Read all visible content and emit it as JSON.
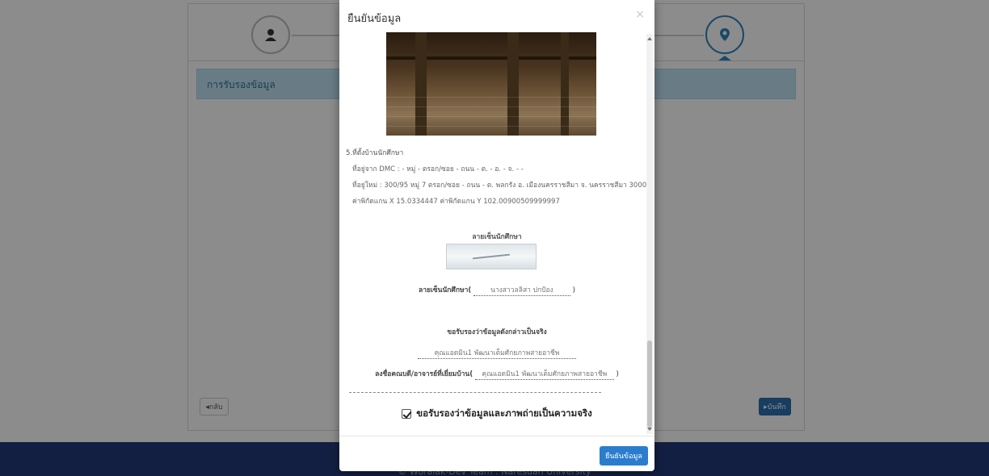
{
  "background_page": {
    "info_bar_title": "การรับรองข้อมูล",
    "back_label": "◂กลับ",
    "next_label": "▸บันทึก",
    "footer_text": "© Woralak-Dev Team : Naresuan University"
  },
  "modal": {
    "title": "ยืนยันข้อมูล",
    "close_symbol": "×",
    "section_title": "5.ที่ตั้งบ้านนักศึกษา",
    "address_dmc": "ที่อยู่จาก DMC : - หมู่ - ตรอก/ซอย - ถนน - ต. - อ. - จ. - -",
    "address_new": "ที่อยู่ใหม่ : 300/95 หมู่ 7 ตรอก/ซอย - ถนน - ต. พลกรัง อ. เมืองนครราชสีมา จ. นครราชสีมา 30000",
    "coordinates": "ค่าพิกัดแกน X 15.0334447 ค่าพิกัดแกน Y 102.00900509999997",
    "signature_title": "ลายเซ็นนักศึกษา",
    "signature_label": "ลายเซ็นนักศึกษา",
    "signature_name": "นางสาวลลิสา ปกป้อง",
    "confirm_title": "ขอรับรองว่าข้อมูลดังกล่าวเป็นจริง",
    "confirm_name": "คุณแอดมิน1 พัฒนาเต็มศักยภาพสายอาชีพ",
    "teacher_label": "ลงชื่อคณบดี/อาจารย์ที่เยี่ยมบ้าน",
    "teacher_name": "คุณแอดมิน1 พัฒนาเต็มศักยภาพสายอาชีพ",
    "checkbox_label": "ขอรับรองว่าข้อมูลและภาพถ่ายเป็นความจริง",
    "checkbox_checked": true,
    "confirm_button": "ยืนยันข้อมูล"
  },
  "colors": {
    "primary": "#2a7dcd",
    "footer": "#233a78",
    "info_bar": "#bfe2f5"
  }
}
